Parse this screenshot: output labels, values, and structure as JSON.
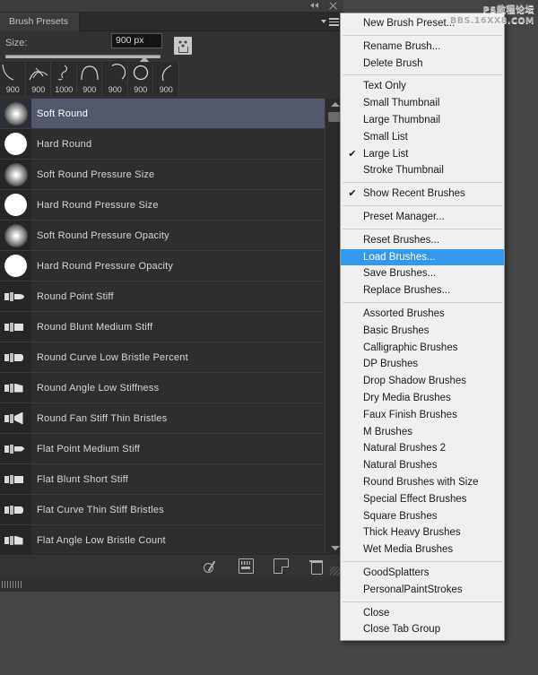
{
  "window": {
    "titlebar_icons": [
      "collapse-icon",
      "close-icon"
    ]
  },
  "panel": {
    "tab_label": "Brush Presets",
    "menu_button_icon": "panel-menu-icon",
    "size": {
      "label": "Size:",
      "value": "900 px",
      "slider_percent": 86,
      "load_brush_icon": "brush-tip-icon"
    },
    "recent_brushes": [
      {
        "size": "900",
        "shape": "arc-open"
      },
      {
        "size": "900",
        "shape": "wing-strokes"
      },
      {
        "size": "1000",
        "shape": "spiral-loop"
      },
      {
        "size": "900",
        "shape": "arc-dome"
      },
      {
        "size": "900",
        "shape": "arc-ring"
      },
      {
        "size": "900",
        "shape": "circle-ring"
      },
      {
        "size": "900",
        "shape": "arc-crescent"
      }
    ],
    "brushes": [
      {
        "name": "Soft Round",
        "thumb": "soft-round",
        "selected": true
      },
      {
        "name": "Hard Round",
        "thumb": "hard-round",
        "selected": false
      },
      {
        "name": "Soft Round Pressure Size",
        "thumb": "soft-round",
        "selected": false
      },
      {
        "name": "Hard Round Pressure Size",
        "thumb": "hard-round",
        "selected": false
      },
      {
        "name": "Soft Round Pressure Opacity",
        "thumb": "soft-round",
        "selected": false
      },
      {
        "name": "Hard Round Pressure Opacity",
        "thumb": "hard-round",
        "selected": false
      },
      {
        "name": "Round Point Stiff",
        "thumb": "bristle-point",
        "selected": false
      },
      {
        "name": "Round Blunt Medium Stiff",
        "thumb": "bristle-blunt",
        "selected": false
      },
      {
        "name": "Round Curve Low Bristle Percent",
        "thumb": "bristle-curve",
        "selected": false
      },
      {
        "name": "Round Angle Low Stiffness",
        "thumb": "bristle-angle",
        "selected": false
      },
      {
        "name": "Round Fan Stiff Thin Bristles",
        "thumb": "bristle-fan",
        "selected": false
      },
      {
        "name": "Flat Point Medium Stiff",
        "thumb": "bristle-flatpoint",
        "selected": false
      },
      {
        "name": "Flat Blunt Short Stiff",
        "thumb": "bristle-blunt",
        "selected": false
      },
      {
        "name": "Flat Curve Thin Stiff Bristles",
        "thumb": "bristle-curve",
        "selected": false
      },
      {
        "name": "Flat Angle Low Bristle Count",
        "thumb": "bristle-angle",
        "selected": false
      }
    ],
    "scrollbar": {
      "up_icon": "scroll-up-arrow",
      "down_icon": "scroll-down-arrow"
    },
    "footer_icons": [
      {
        "name": "toggle-brush-pencil-icon"
      },
      {
        "name": "live-tip-brush-preview-icon"
      },
      {
        "name": "new-brush-preset-icon"
      },
      {
        "name": "delete-brush-icon"
      }
    ]
  },
  "flyout_menu": {
    "items": [
      {
        "label": "New Brush Preset...",
        "checked": false,
        "highlight": false
      },
      {
        "sep": true
      },
      {
        "label": "Rename Brush...",
        "checked": false,
        "highlight": false
      },
      {
        "label": "Delete Brush",
        "checked": false,
        "highlight": false
      },
      {
        "sep": true
      },
      {
        "label": "Text Only",
        "checked": false,
        "highlight": false
      },
      {
        "label": "Small Thumbnail",
        "checked": false,
        "highlight": false
      },
      {
        "label": "Large Thumbnail",
        "checked": false,
        "highlight": false
      },
      {
        "label": "Small List",
        "checked": false,
        "highlight": false
      },
      {
        "label": "Large List",
        "checked": true,
        "highlight": false
      },
      {
        "label": "Stroke Thumbnail",
        "checked": false,
        "highlight": false
      },
      {
        "sep": true
      },
      {
        "label": "Show Recent Brushes",
        "checked": true,
        "highlight": false
      },
      {
        "sep": true
      },
      {
        "label": "Preset Manager...",
        "checked": false,
        "highlight": false
      },
      {
        "sep": true
      },
      {
        "label": "Reset Brushes...",
        "checked": false,
        "highlight": false
      },
      {
        "label": "Load Brushes...",
        "checked": false,
        "highlight": true
      },
      {
        "label": "Save Brushes...",
        "checked": false,
        "highlight": false
      },
      {
        "label": "Replace Brushes...",
        "checked": false,
        "highlight": false
      },
      {
        "sep": true
      },
      {
        "label": "Assorted Brushes",
        "checked": false,
        "highlight": false
      },
      {
        "label": "Basic Brushes",
        "checked": false,
        "highlight": false
      },
      {
        "label": "Calligraphic Brushes",
        "checked": false,
        "highlight": false
      },
      {
        "label": "DP Brushes",
        "checked": false,
        "highlight": false
      },
      {
        "label": "Drop Shadow Brushes",
        "checked": false,
        "highlight": false
      },
      {
        "label": "Dry Media Brushes",
        "checked": false,
        "highlight": false
      },
      {
        "label": "Faux Finish Brushes",
        "checked": false,
        "highlight": false
      },
      {
        "label": "M Brushes",
        "checked": false,
        "highlight": false
      },
      {
        "label": "Natural Brushes 2",
        "checked": false,
        "highlight": false
      },
      {
        "label": "Natural Brushes",
        "checked": false,
        "highlight": false
      },
      {
        "label": "Round Brushes with Size",
        "checked": false,
        "highlight": false
      },
      {
        "label": "Special Effect Brushes",
        "checked": false,
        "highlight": false
      },
      {
        "label": "Square Brushes",
        "checked": false,
        "highlight": false
      },
      {
        "label": "Thick Heavy Brushes",
        "checked": false,
        "highlight": false
      },
      {
        "label": "Wet Media Brushes",
        "checked": false,
        "highlight": false
      },
      {
        "sep": true
      },
      {
        "label": "GoodSplatters",
        "checked": false,
        "highlight": false
      },
      {
        "label": "PersonalPaintStrokes",
        "checked": false,
        "highlight": false
      },
      {
        "sep": true
      },
      {
        "label": "Close",
        "checked": false,
        "highlight": false
      },
      {
        "label": "Close Tab Group",
        "checked": false,
        "highlight": false
      }
    ],
    "check_glyph": "✔",
    "highlight_color": "#3399ee"
  },
  "watermark": {
    "line1": "PS教程论坛",
    "line2": "BBS.16XX8.COM"
  }
}
